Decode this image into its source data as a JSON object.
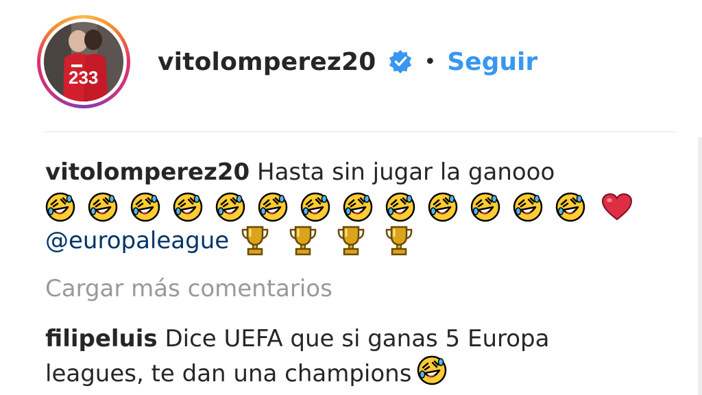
{
  "header": {
    "username": "vitolomperez20",
    "separator": "•",
    "follow_label": "Seguir",
    "verified_icon": "verified-badge-icon",
    "accent_color": "#3897f0"
  },
  "caption": {
    "username": "vitolomperez20",
    "text": "Hasta sin jugar la ganooo",
    "emojis": [
      "rolling-on-floor-laughing",
      "rolling-on-floor-laughing",
      "rolling-on-floor-laughing",
      "rolling-on-floor-laughing",
      "rolling-on-floor-laughing",
      "rolling-on-floor-laughing",
      "rolling-on-floor-laughing",
      "rolling-on-floor-laughing",
      "rolling-on-floor-laughing",
      "rolling-on-floor-laughing",
      "rolling-on-floor-laughing",
      "rolling-on-floor-laughing",
      "rolling-on-floor-laughing",
      "red-heart"
    ],
    "mention": "@europaleague",
    "trophies": [
      "trophy",
      "trophy",
      "trophy",
      "trophy"
    ]
  },
  "load_more_label": "Cargar más comentarios",
  "reply": {
    "username": "filipeluis",
    "text": "Dice UEFA que si ganas 5 Europa leagues, te dan una champions",
    "emoji": "rolling-on-floor-laughing"
  }
}
